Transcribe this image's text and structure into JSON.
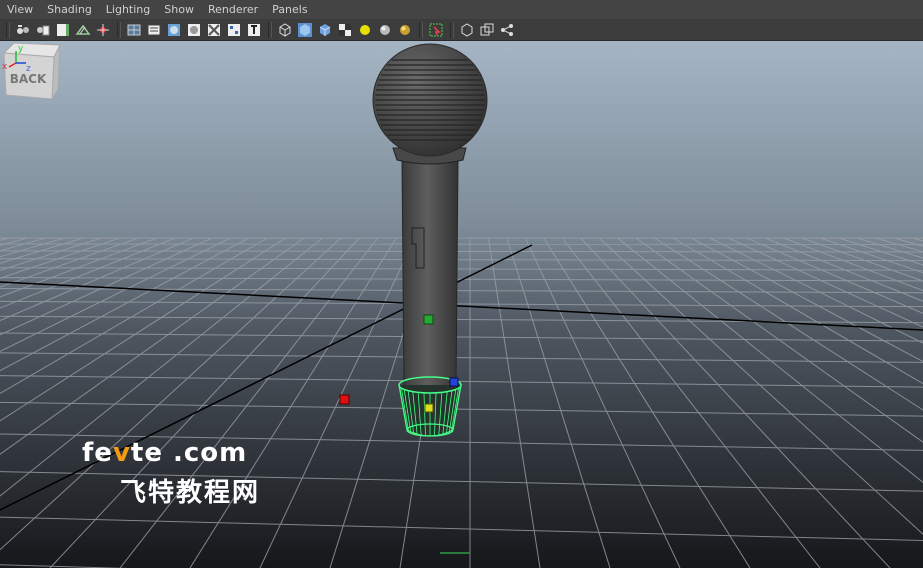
{
  "menu": {
    "items": [
      "View",
      "Shading",
      "Lighting",
      "Show",
      "Renderer",
      "Panels"
    ]
  },
  "toolbar": {
    "icons": [
      "camera-attributes-icon",
      "bookmark-icon",
      "image-plane-icon",
      "grid-icon",
      "select-camera-icon",
      "wireframe-on-shaded-icon",
      "smooth-shade-all-icon",
      "xray-icon",
      "default-material-icon",
      "textured-icon",
      "use-all-lights-icon",
      "wireframe-icon",
      "smooth-shade-icon",
      "flat-shade-icon",
      "bounding-box-icon",
      "point-light-icon",
      "ambient-occlusion-icon",
      "shadows-icon",
      "isolate-select-icon",
      "show-all-icon",
      "sets-icon",
      "graph-icon"
    ]
  },
  "viewport": {
    "viewcube_label": "BACK",
    "axis_labels": {
      "x": "x",
      "y": "y",
      "z": "z"
    },
    "colors": {
      "grid_line": "#9aa0a6",
      "axis_line": "#000000",
      "selection_green": "#44ff88",
      "manip_red": "#dd1111",
      "manip_blue": "#2244dd",
      "manip_yellow": "#dddd22"
    }
  },
  "watermark": {
    "site_prefix": "fe",
    "site_accent": "v",
    "site_suffix": "te .com",
    "site_cn": "飞特教程网"
  }
}
